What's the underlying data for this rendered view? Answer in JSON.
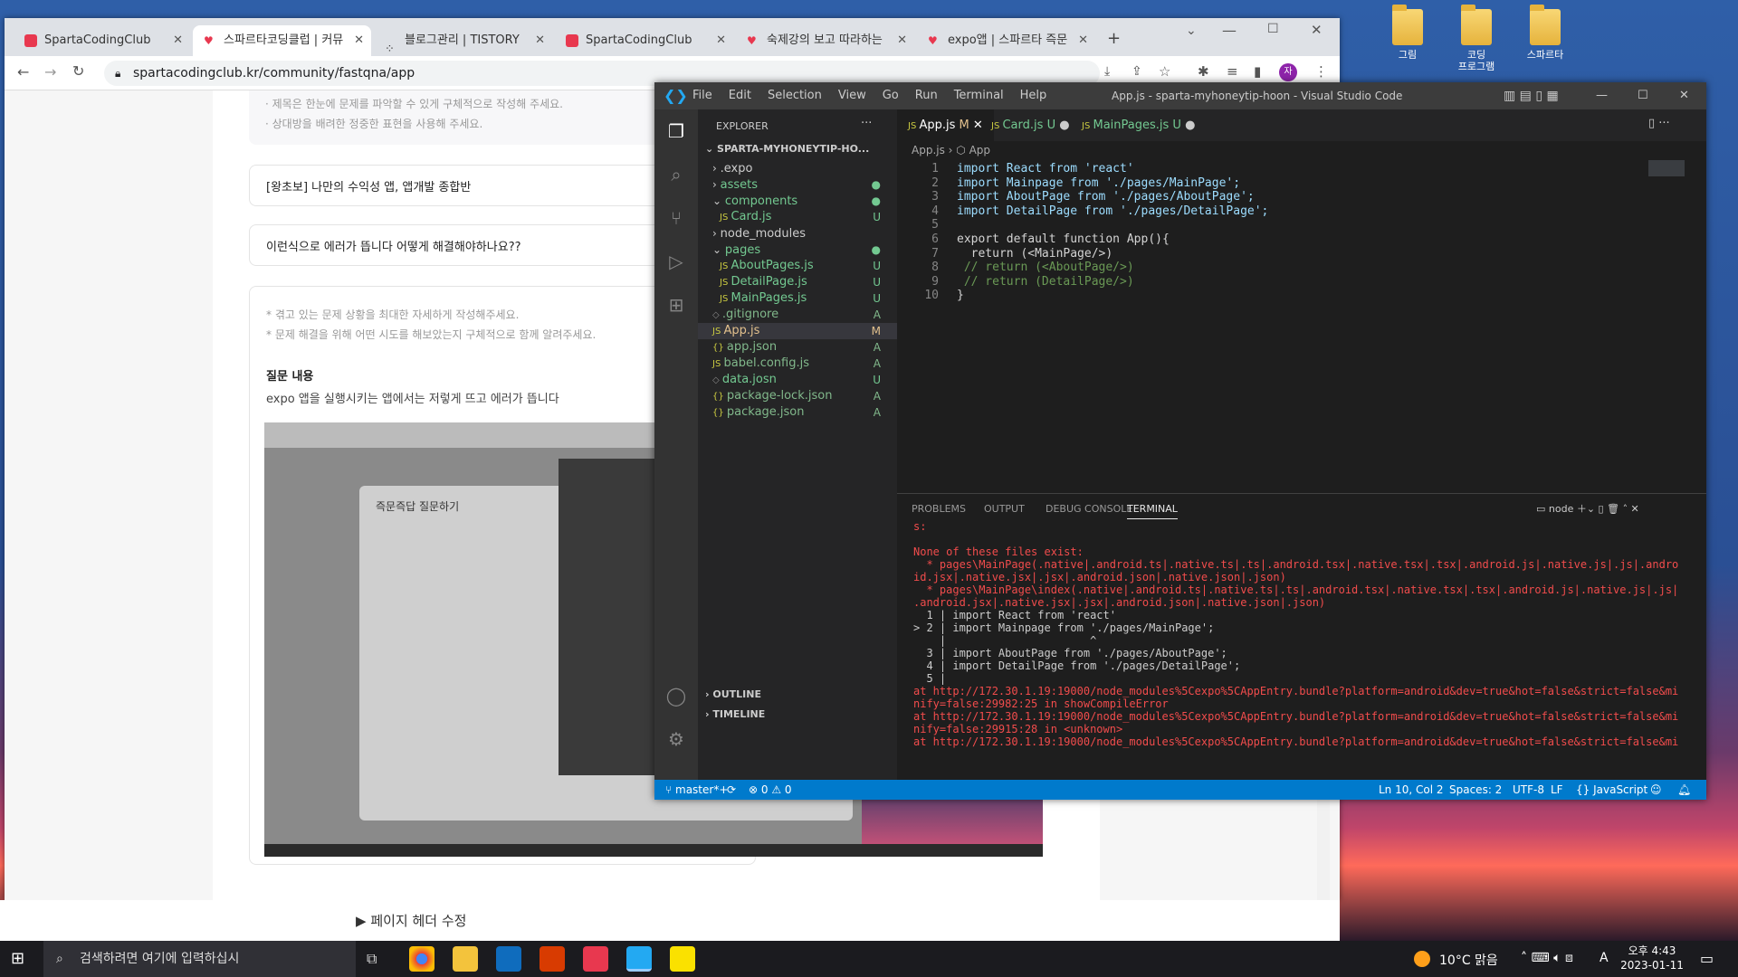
{
  "desktop": {
    "icons": [
      "그림",
      "코딩\n프로그램",
      "스파르타"
    ]
  },
  "browser": {
    "tabs": [
      {
        "label": "SpartaCodingClub"
      },
      {
        "label": "스파르타코딩클럽 | 커뮤"
      },
      {
        "label": "블로그관리 | TISTORY"
      },
      {
        "label": "SpartaCodingClub"
      },
      {
        "label": "숙제강의 보고 따라하는"
      },
      {
        "label": "expo앱 | 스파르타 즉문"
      }
    ],
    "url": "spartacodingclub.kr/community/fastqna/app",
    "page": {
      "guide_lines": [
        "· 제목은 한눈에 문제를 파악할 수 있게 구체적으로 작성해 주세요.",
        "· 상대방을 배려한 정중한 표현을 사용해 주세요."
      ],
      "course_select": "[왕초보] 나만의 수익성 앱, 앱개발 종합반",
      "title_input": "이런식으로 에러가 뜹니다 어떻게 해결해야하나요??",
      "hint1": "* 겪고 있는 문제 상황을 최대한 자세하게 작성해주세요.",
      "hint2": "* 문제 해결을 위해 어떤 시도를 해보았는지 구체적으로 함께 알려주세요.",
      "content_heading": "질문 내용",
      "content_text": "expo 앱을 실행시키는 앱에서는 저렇게 뜨고 에러가 뜹니다",
      "screenshot_heading": "즉문즉답 질문하기",
      "footer_link": "페이지 헤더 수정"
    }
  },
  "vscode": {
    "menu": [
      "File",
      "Edit",
      "Selection",
      "View",
      "Go",
      "Run",
      "Terminal",
      "Help"
    ],
    "title": "App.js - sparta-myhoneytip-hoon - Visual Studio Code",
    "explorer_label": "EXPLORER",
    "project": "SPARTA-MYHONEYTIP-HO...",
    "tree": [
      {
        "name": ".expo",
        "status": "",
        "indent": 1,
        "kind": "folder"
      },
      {
        "name": "assets",
        "status": "●",
        "indent": 1,
        "kind": "folder"
      },
      {
        "name": "components",
        "status": "●",
        "indent": 1,
        "kind": "folder-open"
      },
      {
        "name": "Card.js",
        "status": "U",
        "indent": 2,
        "kind": "js"
      },
      {
        "name": "node_modules",
        "status": "",
        "indent": 1,
        "kind": "folder"
      },
      {
        "name": "pages",
        "status": "●",
        "indent": 1,
        "kind": "folder-open"
      },
      {
        "name": "AboutPages.js",
        "status": "U",
        "indent": 2,
        "kind": "js"
      },
      {
        "name": "DetailPage.js",
        "status": "U",
        "indent": 2,
        "kind": "js"
      },
      {
        "name": "MainPages.js",
        "status": "U",
        "indent": 2,
        "kind": "js"
      },
      {
        "name": ".gitignore",
        "status": "A",
        "indent": 1,
        "kind": "file"
      },
      {
        "name": "App.js",
        "status": "M",
        "indent": 1,
        "kind": "js"
      },
      {
        "name": "app.json",
        "status": "A",
        "indent": 1,
        "kind": "json"
      },
      {
        "name": "babel.config.js",
        "status": "A",
        "indent": 1,
        "kind": "js"
      },
      {
        "name": "data.josn",
        "status": "U",
        "indent": 1,
        "kind": "file"
      },
      {
        "name": "package-lock.json",
        "status": "A",
        "indent": 1,
        "kind": "json"
      },
      {
        "name": "package.json",
        "status": "A",
        "indent": 1,
        "kind": "json"
      }
    ],
    "outline": "OUTLINE",
    "timeline": "TIMELINE",
    "tabs": [
      {
        "label": "App.js",
        "badge": "M"
      },
      {
        "label": "Card.js",
        "badge": "U"
      },
      {
        "label": "MainPages.js",
        "badge": "U"
      }
    ],
    "breadcrumb": [
      "App.js",
      "App"
    ],
    "code": [
      "import React from 'react'",
      "import Mainpage from './pages/MainPage';",
      "import AboutPage from './pages/AboutPage';",
      "import DetailPage from './pages/DetailPage';",
      "",
      "export default function App(){",
      "  return (<MainPage/>)",
      " // return (<AboutPage/>)",
      " // return (DetailPage/>)",
      "}"
    ],
    "panel_tabs": [
      "PROBLEMS",
      "OUTPUT",
      "DEBUG CONSOLE",
      "TERMINAL"
    ],
    "terminal_shell": "node",
    "terminal": [
      "s:",
      "",
      "None of these files exist:",
      "  * pages\\MainPage(.native|.android.ts|.native.ts|.ts|.android.tsx|.native.tsx|.tsx|.android.js|.native.js|.js|.andro",
      "id.jsx|.native.jsx|.jsx|.android.json|.native.json|.json)",
      "  * pages\\MainPage\\index(.native|.android.ts|.native.ts|.ts|.android.tsx|.native.tsx|.tsx|.android.js|.native.js|.js|",
      ".android.jsx|.native.jsx|.jsx|.android.json|.native.json|.json)",
      "  1 | import React from 'react'",
      "> 2 | import Mainpage from './pages/MainPage';",
      "    |                      ^",
      "  3 | import AboutPage from './pages/AboutPage';",
      "  4 | import DetailPage from './pages/DetailPage';",
      "  5 |",
      "at http://172.30.1.19:19000/node_modules%5Cexpo%5CAppEntry.bundle?platform=android&dev=true&hot=false&strict=false&mi",
      "nify=false:29982:25 in showCompileError",
      "at http://172.30.1.19:19000/node_modules%5Cexpo%5CAppEntry.bundle?platform=android&dev=true&hot=false&strict=false&mi",
      "nify=false:29915:28 in <unknown>",
      "at http://172.30.1.19:19000/node_modules%5Cexpo%5CAppEntry.bundle?platform=android&dev=true&hot=false&strict=false&mi"
    ],
    "status": {
      "branch": "master*+",
      "errors": "0",
      "warnings": "0",
      "position": "Ln 10, Col 2",
      "spaces": "Spaces: 2",
      "encoding": "UTF-8",
      "eol": "LF",
      "language": "JavaScript"
    }
  },
  "taskbar": {
    "search_placeholder": "검색하려면 여기에 입력하십시",
    "weather": "10°C 맑음",
    "time": "오후 4:43",
    "date": "2023-01-11",
    "ime": "A"
  }
}
